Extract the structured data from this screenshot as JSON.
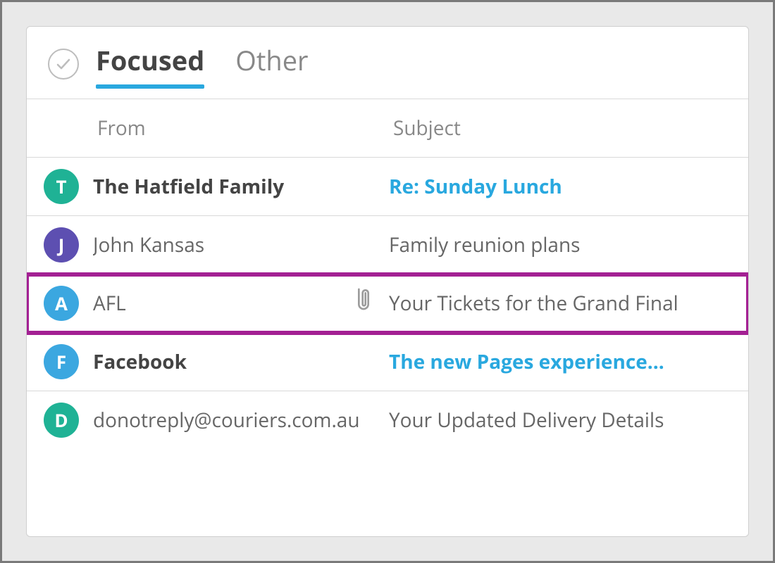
{
  "tabs": {
    "focused": "Focused",
    "other": "Other",
    "active": "focused"
  },
  "columns": {
    "from": "From",
    "subject": "Subject"
  },
  "colors": {
    "accent": "#29a8df",
    "highlight": "#a32093"
  },
  "messages": [
    {
      "avatar_letter": "T",
      "avatar_color": "#1fb295",
      "from": "The Hatfield Family",
      "subject": "Re: Sunday Lunch",
      "unread": true,
      "has_attachment": false,
      "highlighted": false
    },
    {
      "avatar_letter": "J",
      "avatar_color": "#5d4fb1",
      "from": "John Kansas",
      "subject": "Family reunion plans",
      "unread": false,
      "has_attachment": false,
      "highlighted": false
    },
    {
      "avatar_letter": "A",
      "avatar_color": "#3ba7e0",
      "from": "AFL",
      "subject": "Your Tickets for the Grand Final",
      "unread": false,
      "has_attachment": true,
      "highlighted": true
    },
    {
      "avatar_letter": "F",
      "avatar_color": "#3ba7e0",
      "from": "Facebook",
      "subject": "The new Pages experience...",
      "unread": true,
      "has_attachment": false,
      "highlighted": false
    },
    {
      "avatar_letter": "D",
      "avatar_color": "#1fb295",
      "from": "donotreply@couriers.com.au",
      "subject": "Your Updated Delivery Details",
      "unread": false,
      "has_attachment": false,
      "highlighted": false
    }
  ]
}
